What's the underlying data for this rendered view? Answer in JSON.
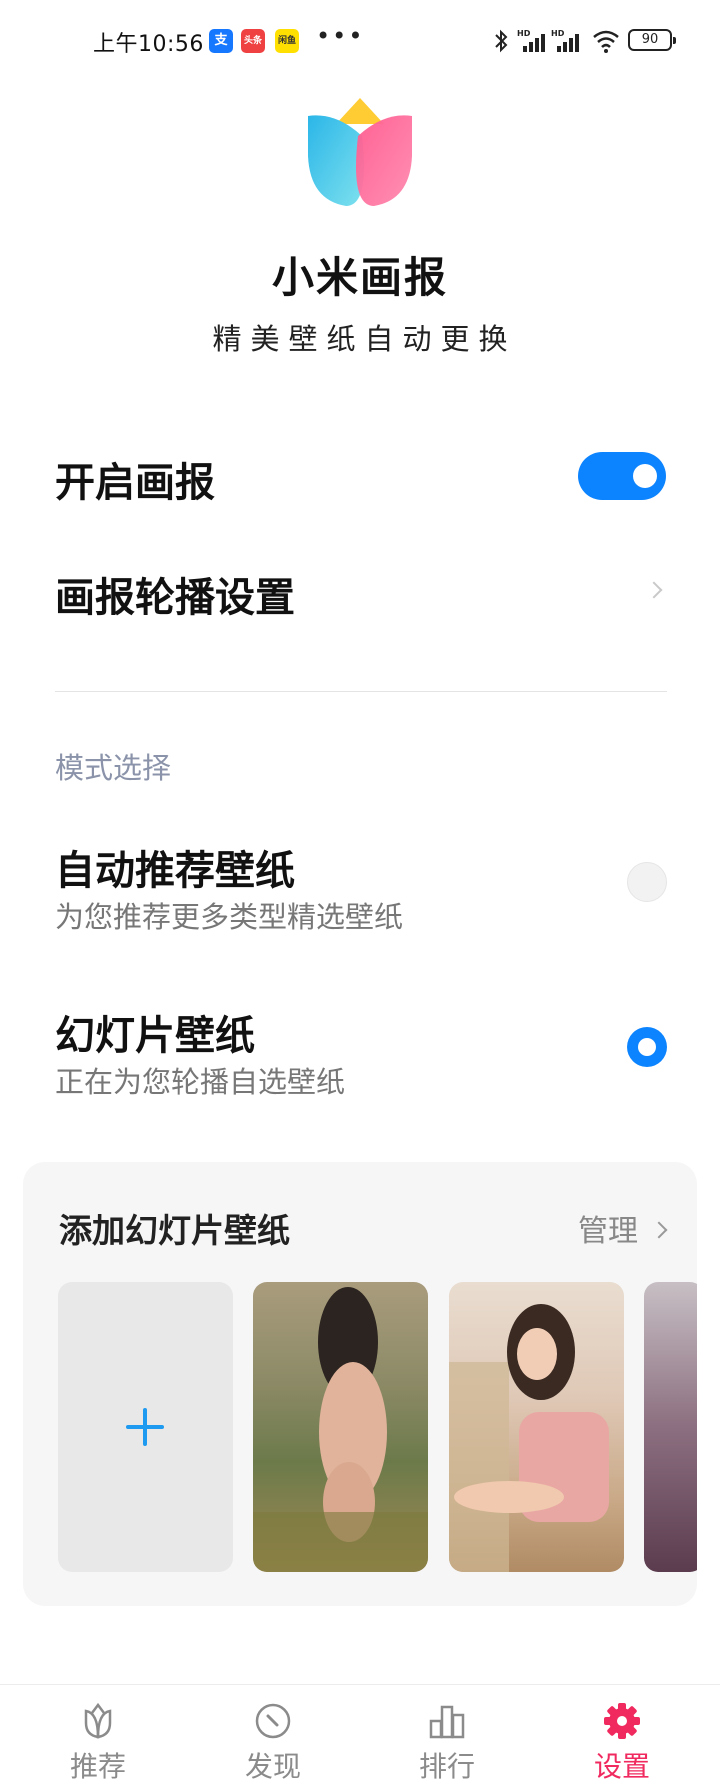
{
  "status_bar": {
    "time": "上午10:56",
    "apps": [
      "支",
      "头条",
      "闲鱼"
    ],
    "more": "•••",
    "battery": "90",
    "signal_label": "HD"
  },
  "header": {
    "title": "小米画报",
    "subtitle": "精美壁纸自动更换"
  },
  "settings": {
    "enable_label": "开启画报",
    "enable_on": true,
    "carousel_label": "画报轮播设置"
  },
  "mode": {
    "section_label": "模式选择",
    "options": [
      {
        "title": "自动推荐壁纸",
        "subtitle": "为您推荐更多类型精选壁纸",
        "selected": false
      },
      {
        "title": "幻灯片壁纸",
        "subtitle": "正在为您轮播自选壁纸",
        "selected": true
      }
    ]
  },
  "slideshow": {
    "title": "添加幻灯片壁纸",
    "manage_label": "管理",
    "add_icon": "plus-icon"
  },
  "nav": {
    "items": [
      {
        "label": "推荐",
        "icon": "tulip-icon",
        "active": false
      },
      {
        "label": "发现",
        "icon": "compass-icon",
        "active": false
      },
      {
        "label": "排行",
        "icon": "bar-chart-icon",
        "active": false
      },
      {
        "label": "设置",
        "icon": "gear-icon",
        "active": true
      }
    ]
  },
  "colors": {
    "accent": "#0d84ff",
    "nav_active": "#f0295f",
    "section_label": "#8a93a9"
  }
}
